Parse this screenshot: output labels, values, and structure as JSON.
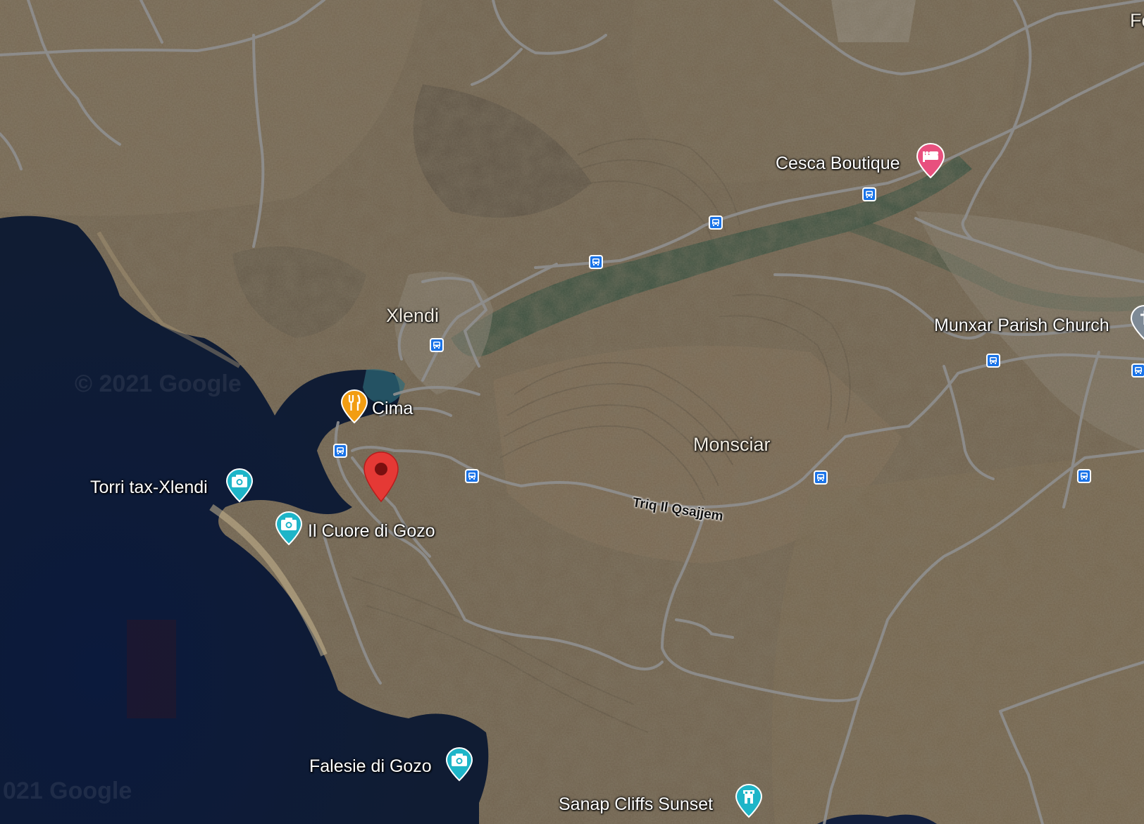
{
  "map": {
    "type": "satellite",
    "place_labels": {
      "xlendi": "Xlendi",
      "monsciar": "Monsciar",
      "corner_partial": "Fo"
    },
    "road_labels": {
      "triq_il_qsajjem": "Triq Il Qsajjem"
    },
    "pois": {
      "cesca_boutique": {
        "name": "Cesca Boutique",
        "icon": "hotel-icon",
        "color": "#e8507e"
      },
      "munxar_parish_church": {
        "name": "Munxar Parish Church",
        "icon": "church-icon",
        "color": "#7e8a96"
      },
      "cima": {
        "name": "Cima",
        "icon": "restaurant-icon",
        "color": "#f29d12"
      },
      "torri_tax_xlendi": {
        "name": "Torri tax-Xlendi",
        "icon": "camera-icon",
        "color": "#1eb5c8"
      },
      "il_cuore_di_gozo": {
        "name": "Il Cuore di Gozo",
        "icon": "camera-icon",
        "color": "#1eb5c8"
      },
      "falesie_di_gozo": {
        "name": "Falesie di Gozo",
        "icon": "camera-icon",
        "color": "#1eb5c8"
      },
      "sanap_cliffs_sunset": {
        "name": "Sanap Cliffs Sunset",
        "icon": "tower-icon",
        "color": "#1eb5c8"
      }
    },
    "selected_pin": {
      "icon": "location-pin-icon",
      "color": "#e53935"
    },
    "transit_stop_icon": "bus-stop-icon",
    "transit_color": "#1a73e8",
    "watermarks": [
      "© 2021 Google",
      "021 Google"
    ]
  }
}
